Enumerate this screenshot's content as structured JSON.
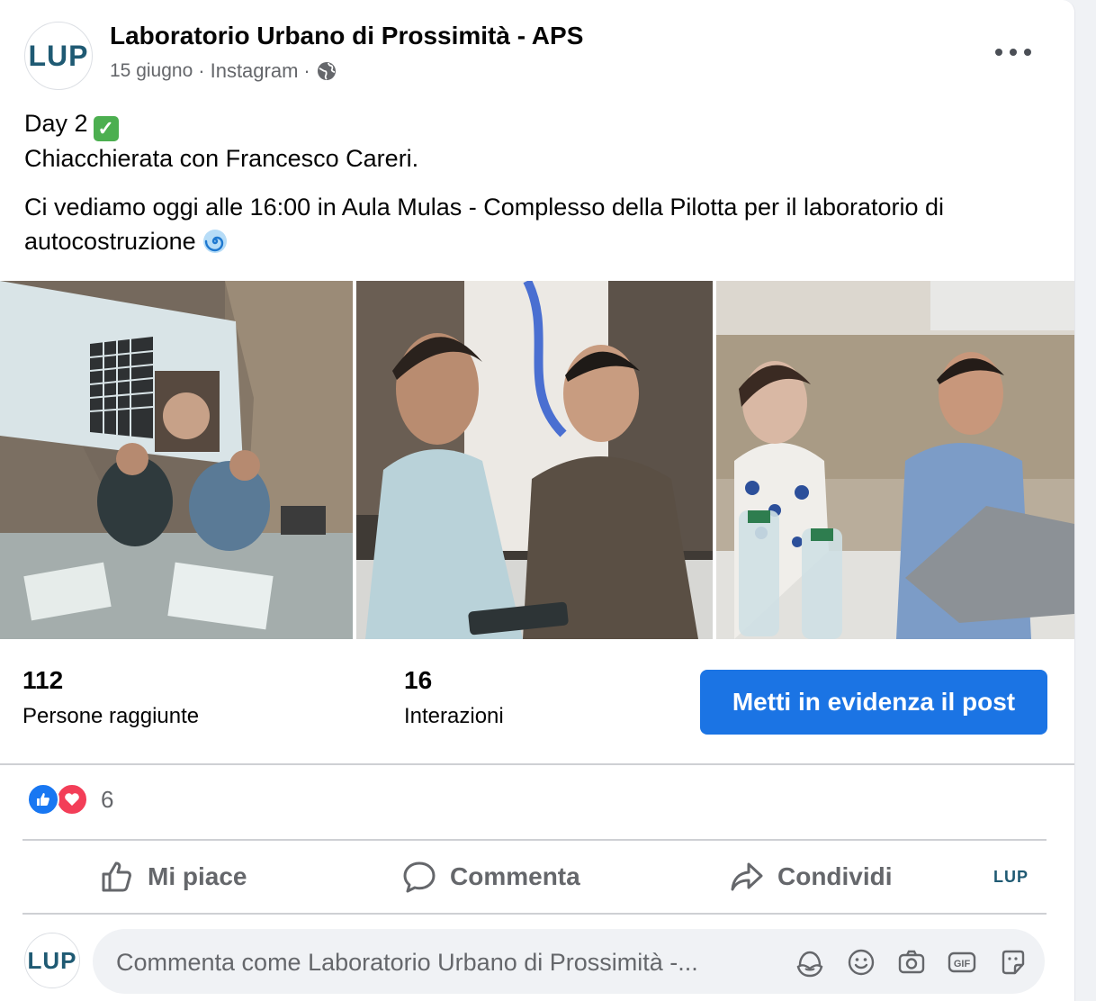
{
  "post": {
    "page_name": "Laboratorio Urbano di Prossimità - APS",
    "avatar_text": "LUP",
    "date": "15 giugno",
    "source": "Instagram",
    "separator": "·",
    "text_line1": "Day 2",
    "text_line2": "Chiacchierata con Francesco Careri.",
    "text_line3": "Ci vediamo oggi alle 16:00 in Aula Mulas - Complesso della Pilotta per il laboratorio di autocostruzione",
    "icons": [
      "globe-icon",
      "check-emoji",
      "swirl-emoji",
      "more-options-icon"
    ]
  },
  "photos": [
    {
      "alt": "photo-1"
    },
    {
      "alt": "photo-2"
    },
    {
      "alt": "photo-3"
    }
  ],
  "stats": {
    "reach_value": "112",
    "reach_label": "Persone raggiunte",
    "interactions_value": "16",
    "interactions_label": "Interazioni",
    "boost_label": "Metti in evidenza il post"
  },
  "reactions": {
    "count": "6",
    "types": [
      "like",
      "love"
    ]
  },
  "actions": {
    "like_label": "Mi piace",
    "comment_label": "Commenta",
    "share_label": "Condividi",
    "page_switch_text": "LUP"
  },
  "comment": {
    "placeholder": "Commenta come Laboratorio Urbano di Prossimità -...",
    "avatar_text": "LUP",
    "icons": [
      "avatar-sticker-icon",
      "emoji-icon",
      "camera-icon",
      "gif-icon",
      "sticker-icon"
    ]
  },
  "colors": {
    "accent": "#1b74e4",
    "text": "#050505",
    "secondary": "#65676b",
    "brand": "#1f5a73"
  }
}
